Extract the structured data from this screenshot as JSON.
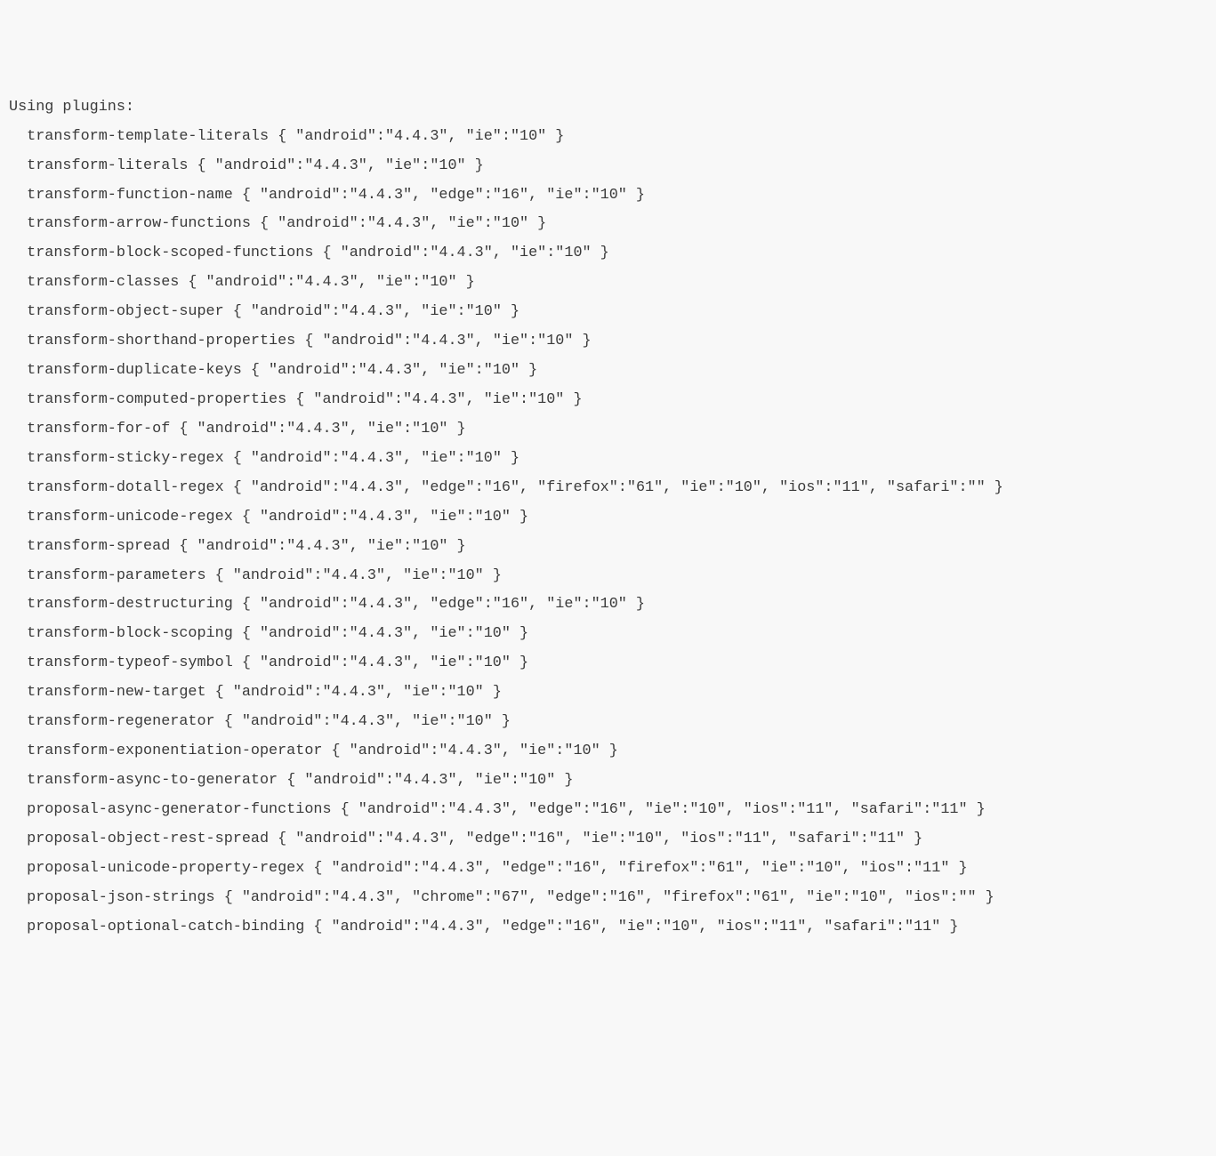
{
  "header": "Using plugins:",
  "plugins": [
    {
      "name": "transform-template-literals",
      "targets": {
        "android": "4.4.3",
        "ie": "10"
      }
    },
    {
      "name": "transform-literals",
      "targets": {
        "android": "4.4.3",
        "ie": "10"
      }
    },
    {
      "name": "transform-function-name",
      "targets": {
        "android": "4.4.3",
        "edge": "16",
        "ie": "10"
      }
    },
    {
      "name": "transform-arrow-functions",
      "targets": {
        "android": "4.4.3",
        "ie": "10"
      }
    },
    {
      "name": "transform-block-scoped-functions",
      "targets": {
        "android": "4.4.3",
        "ie": "10"
      }
    },
    {
      "name": "transform-classes",
      "targets": {
        "android": "4.4.3",
        "ie": "10"
      }
    },
    {
      "name": "transform-object-super",
      "targets": {
        "android": "4.4.3",
        "ie": "10"
      }
    },
    {
      "name": "transform-shorthand-properties",
      "targets": {
        "android": "4.4.3",
        "ie": "10"
      }
    },
    {
      "name": "transform-duplicate-keys",
      "targets": {
        "android": "4.4.3",
        "ie": "10"
      }
    },
    {
      "name": "transform-computed-properties",
      "targets": {
        "android": "4.4.3",
        "ie": "10"
      }
    },
    {
      "name": "transform-for-of",
      "targets": {
        "android": "4.4.3",
        "ie": "10"
      }
    },
    {
      "name": "transform-sticky-regex",
      "targets": {
        "android": "4.4.3",
        "ie": "10"
      }
    },
    {
      "name": "transform-dotall-regex",
      "targets": {
        "android": "4.4.3",
        "edge": "16",
        "firefox": "61",
        "ie": "10",
        "ios": "11",
        "safari": ""
      }
    },
    {
      "name": "transform-unicode-regex",
      "targets": {
        "android": "4.4.3",
        "ie": "10"
      }
    },
    {
      "name": "transform-spread",
      "targets": {
        "android": "4.4.3",
        "ie": "10"
      }
    },
    {
      "name": "transform-parameters",
      "targets": {
        "android": "4.4.3",
        "ie": "10"
      }
    },
    {
      "name": "transform-destructuring",
      "targets": {
        "android": "4.4.3",
        "edge": "16",
        "ie": "10"
      }
    },
    {
      "name": "transform-block-scoping",
      "targets": {
        "android": "4.4.3",
        "ie": "10"
      }
    },
    {
      "name": "transform-typeof-symbol",
      "targets": {
        "android": "4.4.3",
        "ie": "10"
      }
    },
    {
      "name": "transform-new-target",
      "targets": {
        "android": "4.4.3",
        "ie": "10"
      }
    },
    {
      "name": "transform-regenerator",
      "targets": {
        "android": "4.4.3",
        "ie": "10"
      }
    },
    {
      "name": "transform-exponentiation-operator",
      "targets": {
        "android": "4.4.3",
        "ie": "10"
      }
    },
    {
      "name": "transform-async-to-generator",
      "targets": {
        "android": "4.4.3",
        "ie": "10"
      }
    },
    {
      "name": "proposal-async-generator-functions",
      "targets": {
        "android": "4.4.3",
        "edge": "16",
        "ie": "10",
        "ios": "11",
        "safari": "11"
      }
    },
    {
      "name": "proposal-object-rest-spread",
      "targets": {
        "android": "4.4.3",
        "edge": "16",
        "ie": "10",
        "ios": "11",
        "safari": "11"
      }
    },
    {
      "name": "proposal-unicode-property-regex",
      "targets": {
        "android": "4.4.3",
        "edge": "16",
        "firefox": "61",
        "ie": "10",
        "ios": "11"
      }
    },
    {
      "name": "proposal-json-strings",
      "targets": {
        "android": "4.4.3",
        "chrome": "67",
        "edge": "16",
        "firefox": "61",
        "ie": "10",
        "ios": ""
      }
    },
    {
      "name": "proposal-optional-catch-binding",
      "targets": {
        "android": "4.4.3",
        "edge": "16",
        "ie": "10",
        "ios": "11",
        "safari": "11"
      }
    }
  ]
}
